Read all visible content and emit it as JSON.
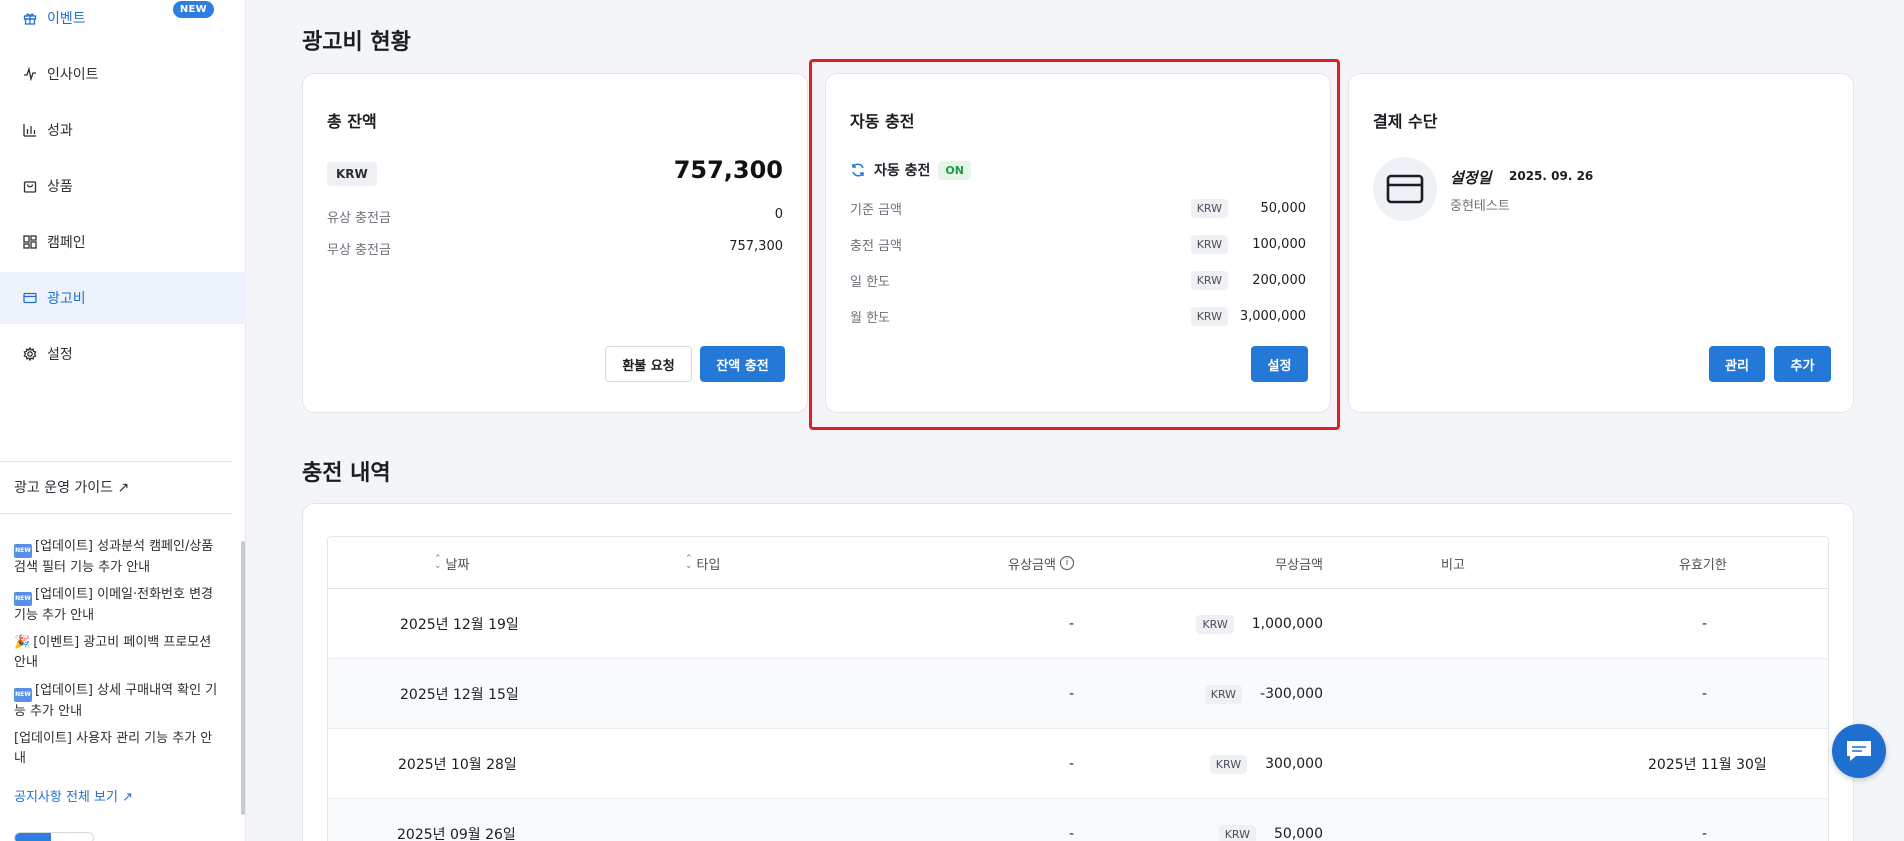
{
  "sidebar": {
    "items": [
      {
        "label": "이벤트",
        "icon": "gift-icon",
        "badge": "NEW"
      },
      {
        "label": "인사이트",
        "icon": "activity-icon"
      },
      {
        "label": "성과",
        "icon": "bar-chart-icon"
      },
      {
        "label": "상품",
        "icon": "shopping-bag-icon"
      },
      {
        "label": "캠페인",
        "icon": "grid-icon"
      },
      {
        "label": "광고비",
        "icon": "credit-card-icon",
        "active": true
      },
      {
        "label": "설정",
        "icon": "gear-icon"
      }
    ],
    "guide_link": "광고 운영 가이드",
    "notices": [
      {
        "prefix": "NEW",
        "text": "[업데이트] 성과분석 캠페인/상품 검색 필터 기능 추가 안내"
      },
      {
        "prefix": "NEW",
        "text": "[업데이트] 이메일·전화번호 변경 기능 추가 안내"
      },
      {
        "prefix": "🎉",
        "text": "[이벤트] 광고비 페이백 프로모션 안내"
      },
      {
        "prefix": "NEW",
        "text": "[업데이트] 상세 구매내역 확인 기능 추가 안내"
      },
      {
        "prefix": "",
        "text": "[업데이트] 사용자 관리 기능 추가 안내"
      }
    ],
    "notice_all": "공지사항 전체 보기"
  },
  "ad_cost": {
    "title": "광고비 현황",
    "balance": {
      "title": "총 잔액",
      "currency": "KRW",
      "amount": "757,300",
      "paid_label": "유상 충전금",
      "paid_value": "0",
      "free_label": "무상 충전금",
      "free_value": "757,300",
      "refund_button": "환불 요청",
      "charge_button": "잔액 충전"
    },
    "auto_charge": {
      "title": "자동 충전",
      "status_label": "자동 충전",
      "status": "ON",
      "rows": [
        {
          "label": "기준 금액",
          "currency": "KRW",
          "value": "50,000"
        },
        {
          "label": "충전 금액",
          "currency": "KRW",
          "value": "100,000"
        },
        {
          "label": "일 한도",
          "currency": "KRW",
          "value": "200,000"
        },
        {
          "label": "월 한도",
          "currency": "KRW",
          "value": "3,000,000"
        }
      ],
      "settings_button": "설정"
    },
    "payment": {
      "title": "결제 수단",
      "set_label": "설정일",
      "set_date": "2025. 09. 26",
      "name": "중현테스트",
      "manage_button": "관리",
      "add_button": "추가"
    }
  },
  "history": {
    "title": "충전 내역",
    "columns": [
      "날짜",
      "타입",
      "유상금액",
      "무상금액",
      "비고",
      "유효기한"
    ],
    "rows": [
      {
        "date": "2025년 12월 19일",
        "type": "",
        "paid": "-",
        "currency": "KRW",
        "free": "1,000,000",
        "note": "",
        "expiry": "-"
      },
      {
        "date": "2025년 12월 15일",
        "type": "",
        "paid": "-",
        "currency": "KRW",
        "free": "-300,000",
        "note": "",
        "expiry": "-"
      },
      {
        "date": "2025년 10월 28일",
        "type": "",
        "paid": "-",
        "currency": "KRW",
        "free": "300,000",
        "note": "",
        "expiry": "2025년 11월 30일"
      },
      {
        "date": "2025년 09월 26일",
        "type": "",
        "paid": "-",
        "currency": "KRW",
        "free": "50,000",
        "note": "",
        "expiry": "-"
      }
    ]
  },
  "colors": {
    "accent": "#2479d8",
    "highlight": "#e02020",
    "on_green": "#1e9a3f"
  }
}
